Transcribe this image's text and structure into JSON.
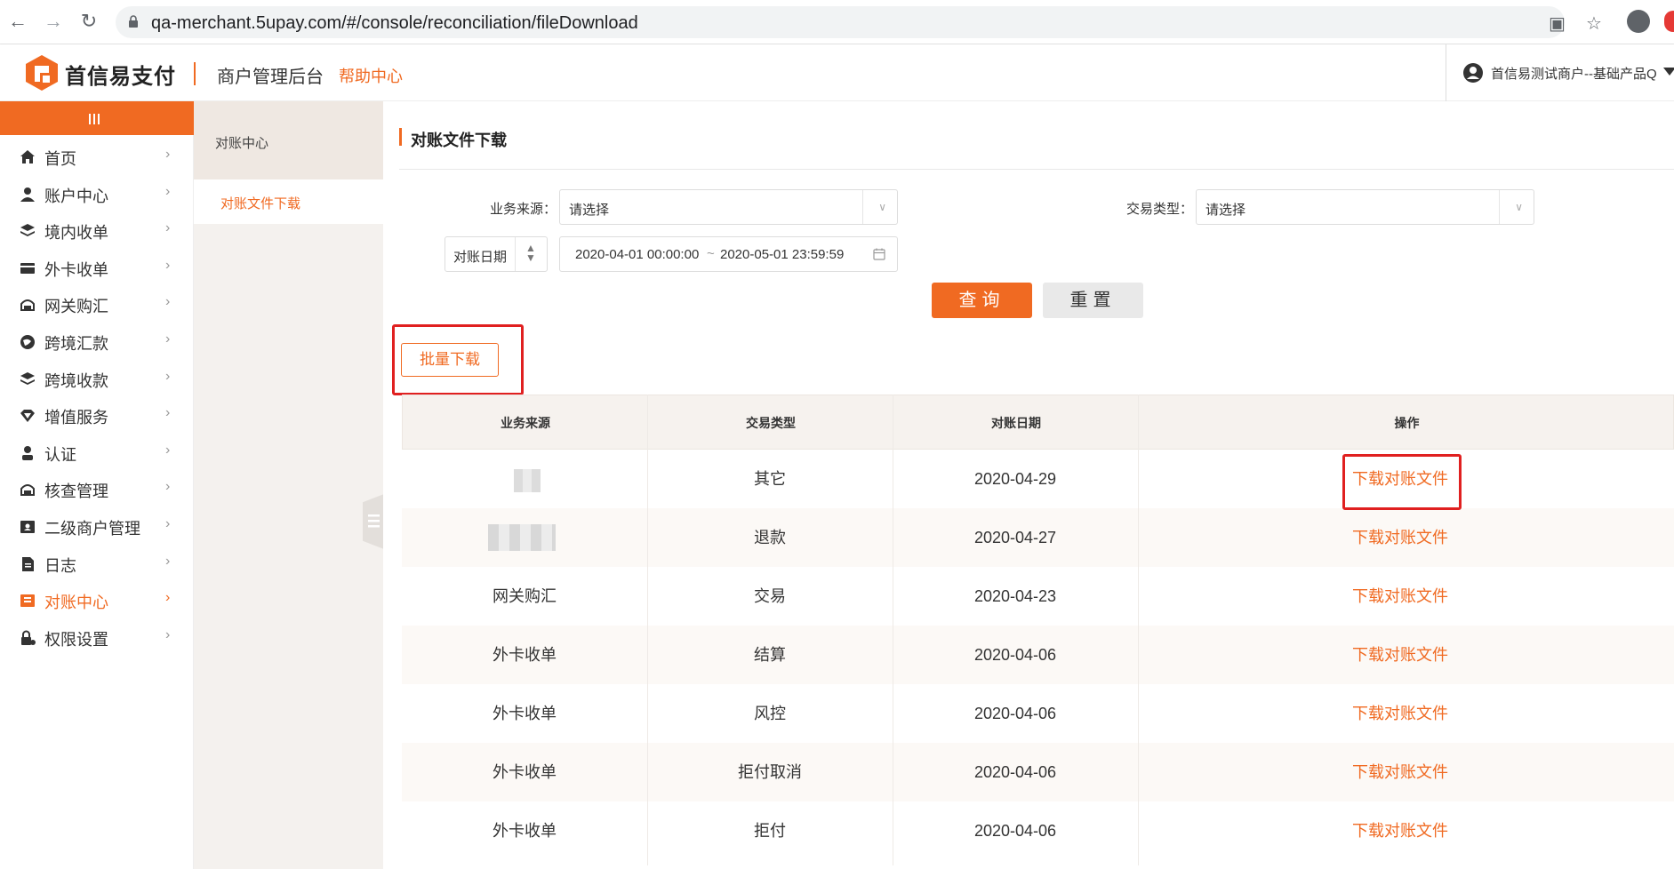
{
  "browser": {
    "url": "qa-merchant.5upay.com/#/console/reconciliation/fileDownload",
    "back_icon": "arrow-left-icon",
    "forward_icon": "arrow-right-icon",
    "reload_icon": "reload-icon"
  },
  "header": {
    "brand": "首信易支付",
    "system_title": "商户管理后台",
    "help_link": "帮助中心",
    "user_name": "首信易测试商户--基础产品Q",
    "accent_color": "#f06a22"
  },
  "sidebar": {
    "items": [
      {
        "label": "首页",
        "icon": "home-icon"
      },
      {
        "label": "账户中心",
        "icon": "user-icon"
      },
      {
        "label": "境内收单",
        "icon": "layers-icon"
      },
      {
        "label": "外卡收单",
        "icon": "card-icon"
      },
      {
        "label": "网关购汇",
        "icon": "gateway-icon"
      },
      {
        "label": "跨境汇款",
        "icon": "globe-icon"
      },
      {
        "label": "跨境收款",
        "icon": "layers-icon"
      },
      {
        "label": "增值服务",
        "icon": "diamond-icon"
      },
      {
        "label": "认证",
        "icon": "person-icon"
      },
      {
        "label": "核查管理",
        "icon": "gateway-icon"
      },
      {
        "label": "二级商户管理",
        "icon": "id-card-icon"
      },
      {
        "label": "日志",
        "icon": "document-icon"
      },
      {
        "label": "对账中心",
        "icon": "reconcile-icon",
        "active": true
      },
      {
        "label": "权限设置",
        "icon": "lock-icon"
      }
    ]
  },
  "subpanel": {
    "header": "对账中心",
    "item": "对账文件下载"
  },
  "main": {
    "title": "对账文件下载",
    "filters": {
      "source_label": "业务来源：",
      "source_value": "请选择",
      "type_label": "交易类型：",
      "type_value": "请选择",
      "date_type": "对账日期",
      "date_start": "2020-04-01 00:00:00",
      "date_sep": "~",
      "date_end": "2020-05-01 23:59:59"
    },
    "query_button": "查询",
    "reset_button": "重置",
    "batch_button": "批量下载"
  },
  "table": {
    "columns": [
      "业务来源",
      "交易类型",
      "对账日期",
      "操作"
    ],
    "rows": [
      {
        "source": "",
        "type": "其它",
        "date": "2020-04-29",
        "action": "下载对账文件"
      },
      {
        "source": "",
        "type": "退款",
        "date": "2020-04-27",
        "action": "下载对账文件"
      },
      {
        "source": "网关购汇",
        "type": "交易",
        "date": "2020-04-23",
        "action": "下载对账文件"
      },
      {
        "source": "外卡收单",
        "type": "结算",
        "date": "2020-04-06",
        "action": "下载对账文件"
      },
      {
        "source": "外卡收单",
        "type": "风控",
        "date": "2020-04-06",
        "action": "下载对账文件"
      },
      {
        "source": "外卡收单",
        "type": "拒付取消",
        "date": "2020-04-06",
        "action": "下载对账文件"
      },
      {
        "source": "外卡收单",
        "type": "拒付",
        "date": "2020-04-06",
        "action": "下载对账文件"
      }
    ]
  }
}
